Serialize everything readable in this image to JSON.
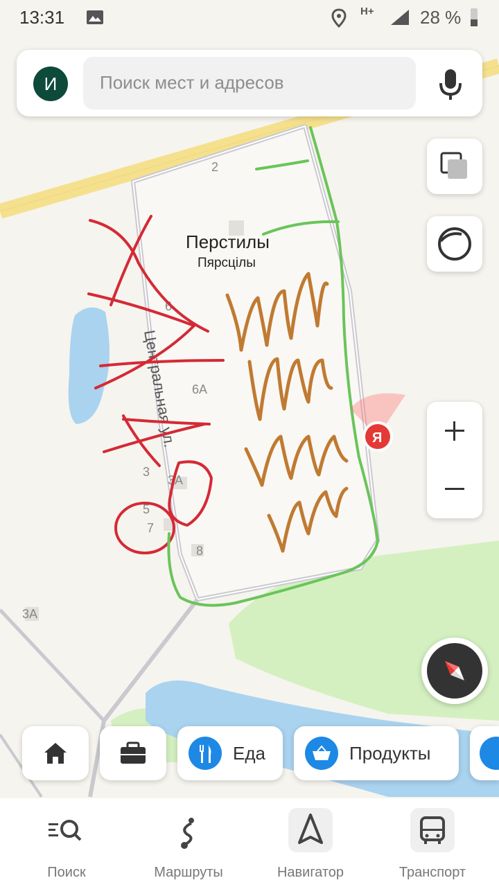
{
  "status_bar": {
    "time": "13:31",
    "network": "H+",
    "battery": "28 %"
  },
  "search": {
    "avatar_letter": "И",
    "placeholder": "Поиск мест и адресов"
  },
  "map": {
    "place_name": "Перстилы",
    "place_name_be": "Пярсцiлы",
    "street_name": "Центральная ул.",
    "house_numbers": {
      "h2": "2",
      "h6": "6",
      "h6a": "6А",
      "h3": "3",
      "h3a": "3А",
      "h5": "5",
      "h7": "7",
      "h8": "8",
      "h3a_far": "3А"
    },
    "location_marker": "Я"
  },
  "chips": {
    "food": "Еда",
    "groceries": "Продукты"
  },
  "bottom_nav": {
    "search": "Поиск",
    "routes": "Маршруты",
    "navigator": "Навигатор",
    "transport": "Транспорт"
  },
  "colors": {
    "accent_blue": "#1e88e5",
    "marker_red": "#e53935",
    "water": "#aad3ef",
    "park": "#d4f0c0",
    "road_yellow": "#f5e08e"
  }
}
